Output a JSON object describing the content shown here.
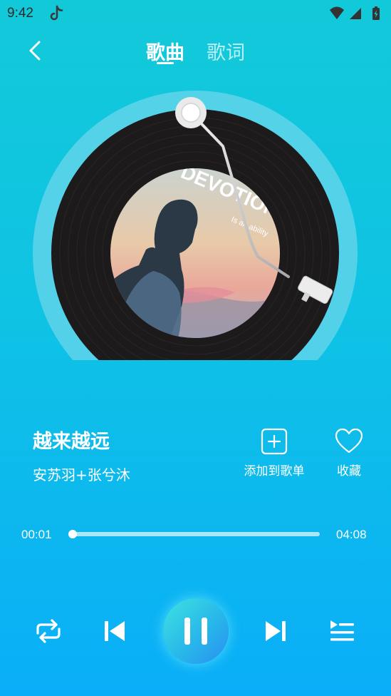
{
  "status_bar": {
    "time": "9:42",
    "icons": [
      "tiktok-notification-icon",
      "wifi-icon",
      "signal-icon",
      "battery-charging-icon"
    ]
  },
  "header": {
    "back_icon": "chevron-left-icon",
    "tabs": [
      {
        "label": "歌曲",
        "active": true
      },
      {
        "label": "歌词",
        "active": false
      }
    ]
  },
  "album": {
    "cover_text_line1": "DEVOTION",
    "cover_text_line2": "Is an ability"
  },
  "song": {
    "title": "越来越远",
    "artist": "安苏羽+张兮沐"
  },
  "actions": {
    "add_playlist_label": "添加到歌单",
    "add_playlist_icon": "plus-square-icon",
    "favorite_label": "收藏",
    "favorite_icon": "heart-outline-icon"
  },
  "progress": {
    "current": "00:01",
    "total": "04:08",
    "fraction": 0.004
  },
  "controls": {
    "icons": [
      "repeat-icon",
      "skip-previous-icon",
      "pause-icon",
      "skip-next-icon",
      "playlist-icon"
    ]
  },
  "colors": {
    "bg_top": "#12c9d9",
    "bg_bottom": "#0aaef8",
    "vinyl": "#1d1a1b",
    "disc_halo": "#5fd3ea",
    "accent_white": "#ffffff"
  }
}
